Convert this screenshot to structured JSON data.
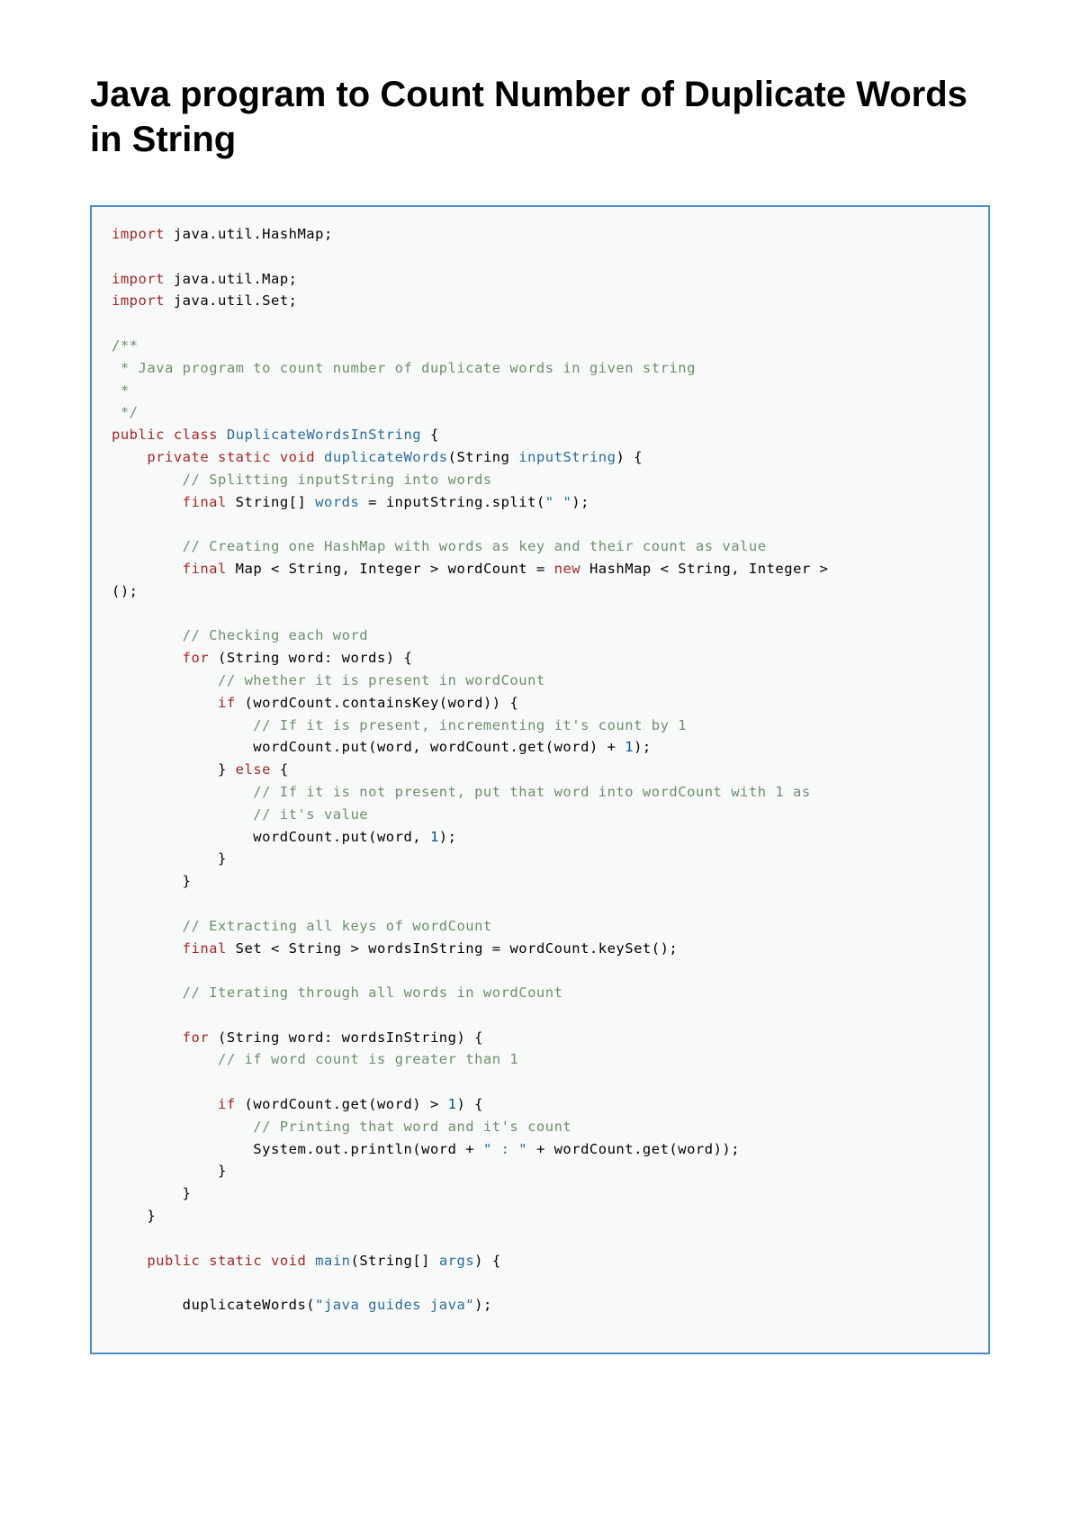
{
  "title": "Java program to Count Number of Duplicate Words in String",
  "code": {
    "l01a": "import",
    "l01b": " java.util.HashMap;",
    "l02a": "import",
    "l02b": " java.util.Map;",
    "l03a": "import",
    "l03b": " java.util.Set;",
    "l04": "/**",
    "l05": " * Java program to count number of duplicate words in given string",
    "l06": " *",
    "l07": " */",
    "l08a": "public",
    "l08b": " class",
    "l08c": " DuplicateWordsInString",
    "l08d": " {",
    "l09a": "    private",
    "l09b": " static",
    "l09c": " void",
    "l09d": " duplicateWords",
    "l09e": "(String ",
    "l09f": "inputString",
    "l09g": ") {",
    "l10a": "        // Splitting inputString into words",
    "l11a": "        final",
    "l11b": " String[] ",
    "l11c": "words",
    "l11d": " = inputString.split(",
    "l11e": "\" \"",
    "l11f": ");",
    "l12a": "        // Creating one HashMap with words as key and their count as value",
    "l13a": "        final",
    "l13b": " Map < String, Integer > wordCount = ",
    "l13c": "new",
    "l13d": " HashMap < String, Integer > ",
    "l13e": "();",
    "l14a": "        // Checking each word",
    "l15a": "        for",
    "l15b": " (String word: words) {",
    "l16a": "            // whether it is present in wordCount",
    "l17a": "            if",
    "l17b": " (wordCount.containsKey(word)) {",
    "l18a": "                // If it is present, incrementing it's count by 1",
    "l19a": "                wordCount.put(word, wordCount.get(word) + ",
    "l19b": "1",
    "l19c": ");",
    "l20a": "            } ",
    "l20b": "else",
    "l20c": " {",
    "l21a": "                // If it is not present, put that word into wordCount with 1 as",
    "l21b": "                // it's value",
    "l22a": "                wordCount.put(word, ",
    "l22b": "1",
    "l22c": ");",
    "l23": "            }",
    "l24": "        }",
    "l25a": "        // Extracting all keys of wordCount",
    "l26a": "        final",
    "l26b": " Set < String > wordsInString = wordCount.keySet();",
    "l27a": "        // Iterating through all words in wordCount",
    "l28a": "        for",
    "l28b": " (String word: wordsInString) {",
    "l29a": "            // if word count is greater than 1",
    "l30a": "            if",
    "l30b": " (wordCount.get(word) > ",
    "l30c": "1",
    "l30d": ") {",
    "l31a": "                // Printing that word and it's count",
    "l32a": "                System.out.println(word + ",
    "l32b": "\" : \"",
    "l32c": " + wordCount.get(word));",
    "l33": "            }",
    "l34": "        }",
    "l35": "    }",
    "l36a": "    public",
    "l36b": " static",
    "l36c": " void",
    "l36d": " main",
    "l36e": "(String[] ",
    "l36f": "args",
    "l36g": ") {",
    "l37a": "        duplicateWords(",
    "l37b": "\"java guides java\"",
    "l37c": ");"
  }
}
